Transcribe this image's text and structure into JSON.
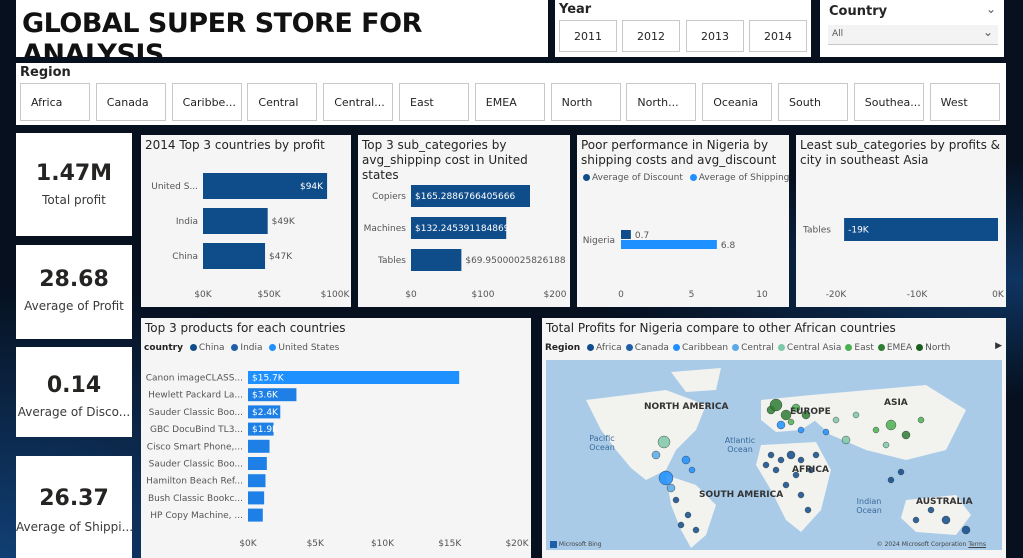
{
  "header": {
    "title": "GLOBAL SUPER STORE FOR ANALYSIS"
  },
  "year_slicer": {
    "label": "Year",
    "options": [
      "2011",
      "2012",
      "2013",
      "2014"
    ]
  },
  "country_slicer": {
    "label": "Country",
    "selected": "All"
  },
  "region_slicer": {
    "label": "Region",
    "options": [
      "Africa",
      "Canada",
      "Caribbe...",
      "Central",
      "Central...",
      "East",
      "EMEA",
      "North",
      "North...",
      "Oceania",
      "South",
      "Southea...",
      "West"
    ]
  },
  "kpis": [
    {
      "value": "1.47M",
      "label": "Total profit"
    },
    {
      "value": "28.68",
      "label": "Average of Profit"
    },
    {
      "value": "0.14",
      "label": "Average of Disco..."
    },
    {
      "value": "26.37",
      "label": "Average of Shippi..."
    }
  ],
  "colors": {
    "dark_blue": "#0f4c8a",
    "light_blue": "#1e90ff",
    "card_bg": "#f5f5f5"
  },
  "chart_data": [
    {
      "type": "bar",
      "title": "2014 Top 3 countries by profit",
      "categories": [
        "United S...",
        "India",
        "China"
      ],
      "values": [
        94000,
        49000,
        47000
      ],
      "data_labels": [
        "$94K",
        "$49K",
        "$47K"
      ],
      "xticks": [
        "$0K",
        "$50K",
        "$100K"
      ],
      "xlim": [
        0,
        100000
      ]
    },
    {
      "type": "bar",
      "title": "Top 3 sub_categories by avg_shippinp cost in United states",
      "categories": [
        "Copiers",
        "Machines",
        "Tables"
      ],
      "values": [
        165.2886766405666,
        132.245391184869,
        69.95000025826188
      ],
      "data_labels": [
        "$165.2886766405666",
        "$132.245391184869",
        "$69.95000025826188"
      ],
      "xticks": [
        "$0",
        "$100",
        "$200"
      ],
      "xlim": [
        0,
        200
      ]
    },
    {
      "type": "bar",
      "title": "Poor performance in Nigeria by shipping costs and avg_discount",
      "legend": [
        "Average of Discount",
        "Average of Shipping_..."
      ],
      "categories": [
        "Nigeria"
      ],
      "series": [
        {
          "name": "Average of Discount",
          "values": [
            0.7
          ]
        },
        {
          "name": "Average of Shipping_...",
          "values": [
            6.8
          ]
        }
      ],
      "xticks": [
        "0",
        "5",
        "10"
      ],
      "xlim": [
        0,
        10
      ]
    },
    {
      "type": "bar",
      "title": "Least sub_categories by profits & city in southeast Asia",
      "categories": [
        "Tables"
      ],
      "values": [
        -19000
      ],
      "data_labels": [
        "-19K"
      ],
      "xticks": [
        "-20K",
        "-10K",
        "0K"
      ],
      "xlim": [
        -20000,
        0
      ]
    },
    {
      "type": "bar",
      "title": "Top 3 products for each countries",
      "legend_title": "country",
      "legend": [
        "China",
        "India",
        "United States"
      ],
      "categories": [
        "Canon imageCLASS...",
        "Hewlett Packard La...",
        "Sauder Classic Boo...",
        "GBC DocuBind TL3...",
        "Cisco Smart Phone,...",
        "Sauder Classic Boo...",
        "Hamilton Beach Ref...",
        "Bush Classic Bookc...",
        "HP Copy Machine, ..."
      ],
      "values": [
        15700,
        3600,
        2400,
        1900,
        1600,
        1400,
        1300,
        1200,
        1100
      ],
      "data_labels": [
        "$15.7K",
        "$3.6K",
        "$2.4K",
        "$1.9K",
        "",
        "",
        "",
        "",
        ""
      ],
      "xticks": [
        "$0K",
        "$5K",
        "$10K",
        "$15K",
        "$20K"
      ],
      "xlim": [
        0,
        20000
      ]
    }
  ],
  "map": {
    "title": "Total Profits for Nigeria compare to other African countries",
    "legend_title": "Region",
    "legend": [
      "Africa",
      "Canada",
      "Caribbean",
      "Central",
      "Central Asia",
      "East",
      "EMEA",
      "North"
    ],
    "legend_colors": [
      "#0f4c8a",
      "#1e5fa8",
      "#1e90ff",
      "#5aa9e6",
      "#7ec8a8",
      "#4caf50",
      "#2e7d32",
      "#1b5e20"
    ],
    "labels": [
      "NORTH AMERICA",
      "EUROPE",
      "ASIA",
      "AFRICA",
      "SOUTH AMERICA",
      "AUSTRALIA"
    ],
    "oceans": [
      "Pacific Ocean",
      "Atlantic Ocean",
      "Indian Ocean"
    ],
    "attribution": "Microsoft Bing",
    "copyright": "© 2024 Microsoft Corporation",
    "terms": "Terms"
  }
}
